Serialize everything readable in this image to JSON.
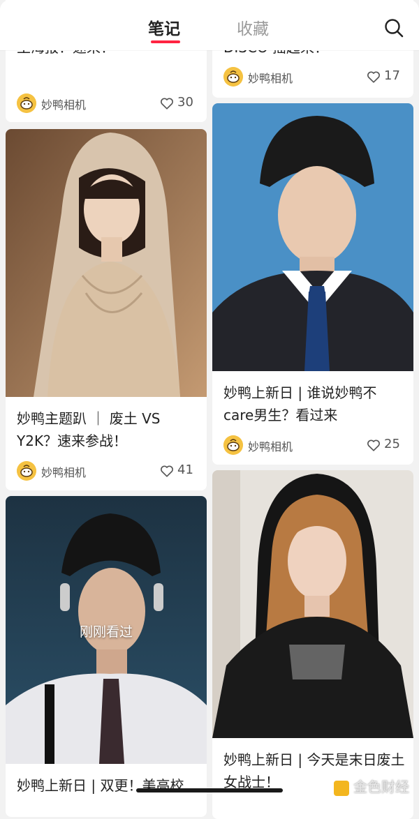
{
  "tabs": [
    {
      "label": "笔记",
      "active": true
    },
    {
      "label": "收藏",
      "active": false
    }
  ],
  "accent_color": "#ff2442",
  "icons": {
    "search": "search-icon",
    "like": "heart-outline-icon",
    "avatar": "duck-avatar-icon"
  },
  "left_column": [
    {
      "title": "妙鸭上新日 | 超潮新韩系公主海报！速来！",
      "title_visible": "主海报！速来！",
      "author": "妙鸭相机",
      "likes": "30"
    },
    {
      "title": "妙鸭主题趴 ｜ 废土 VS Y2K？速来参战！",
      "author": "妙鸭相机",
      "likes": "41"
    },
    {
      "title": "妙鸭上新日 | 双更！美高校",
      "author": "妙鸭相机",
      "likes": "",
      "overlay": "刚刚看过"
    }
  ],
  "right_column": [
    {
      "title": "DISCO 摇起来！",
      "author": "妙鸭相机",
      "likes": "17"
    },
    {
      "title": "妙鸭上新日 | 谁说妙鸭不care男生？看过来",
      "author": "妙鸭相机",
      "likes": "25"
    },
    {
      "title": "妙鸭上新日 | 今天是末日废土女战士！",
      "author": "妙鸭相机",
      "likes": ""
    }
  ],
  "watermark": "金色财经"
}
